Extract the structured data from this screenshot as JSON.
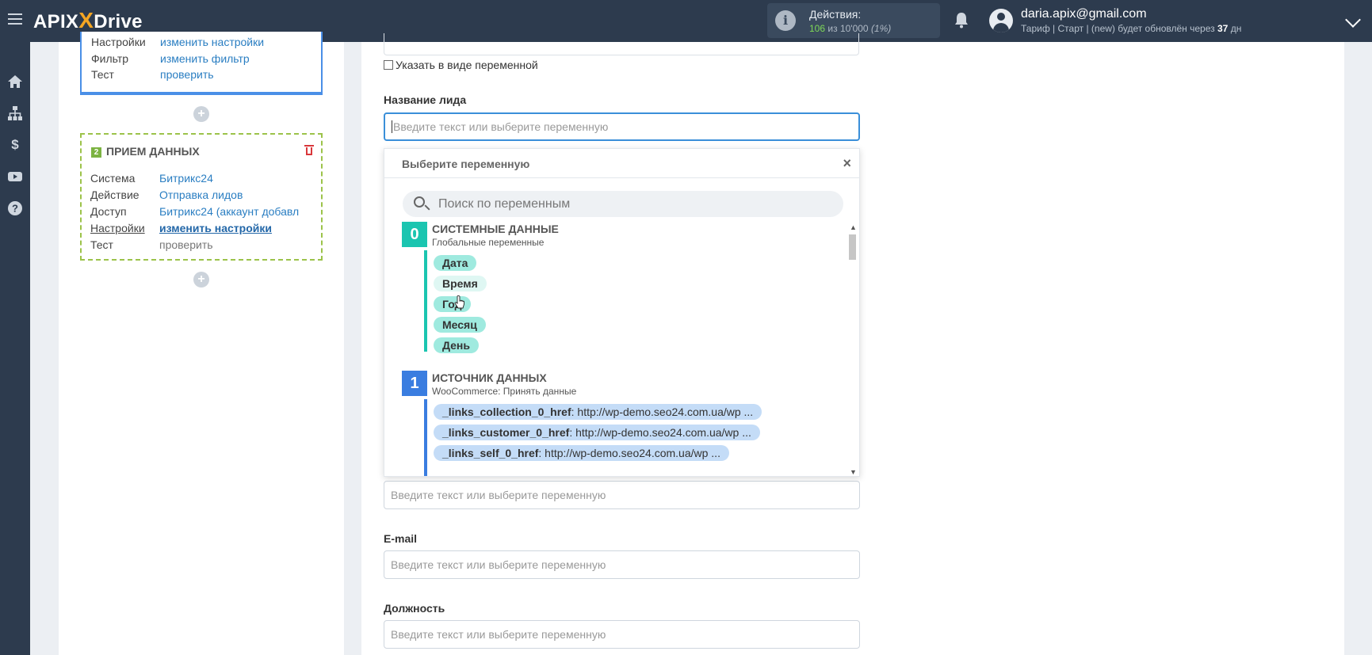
{
  "header": {
    "logo": {
      "left": "APIX",
      "x": "",
      "right": "Drive"
    },
    "actions": {
      "title": "Действия:",
      "used": "106",
      "of_label": "из",
      "total": "10'000",
      "percent": "(1%)"
    },
    "user": {
      "email": "daria.apix@gmail.com",
      "plan_prefix": "Тариф | Старт | (new) будет обновлён через",
      "days": "37",
      "days_unit": "дн"
    }
  },
  "rail": {
    "icons": [
      "home-icon",
      "sitemap-icon",
      "dollar-icon",
      "youtube-icon",
      "help-icon"
    ]
  },
  "step1": {
    "rows": [
      {
        "key": "Настройки",
        "value": "изменить настройки"
      },
      {
        "key": "Фильтр",
        "value": "изменить фильтр"
      },
      {
        "key": "Тест",
        "value": "проверить"
      }
    ]
  },
  "step2": {
    "number": "2",
    "title": "ПРИЕМ ДАННЫХ",
    "rows": [
      {
        "key": "Система",
        "value": "Битрикс24"
      },
      {
        "key": "Действие",
        "value": "Отправка лидов"
      },
      {
        "key": "Доступ",
        "value": "Битрикс24 (аккаунт добавл"
      },
      {
        "key": "Настройки",
        "value": "изменить настройки"
      },
      {
        "key": "Тест",
        "value": "проверить"
      }
    ]
  },
  "form": {
    "checkbox_label": "Указать в виде переменной",
    "lead_name_label": "Название лида",
    "placeholder": "Введите текст или выберите переменную",
    "email_label": "E-mail",
    "position_label": "Должность"
  },
  "dropdown": {
    "title": "Выберите переменную",
    "close": "×",
    "search_placeholder": "Поиск по переменным",
    "sections": [
      {
        "number": "0",
        "title": "СИСТЕМНЫЕ ДАННЫЕ",
        "subtitle": "Глобальные переменные",
        "chips": [
          "Дата",
          "Время",
          "Год",
          "Месяц",
          "День"
        ]
      },
      {
        "number": "1",
        "title": "ИСТОЧНИК ДАННЫХ",
        "subtitle": "WooCommerce: Принять данные",
        "chips": [
          {
            "name": "_links_collection_0_href",
            "value": ": http://wp-demo.seo24.com.ua/wp ..."
          },
          {
            "name": "_links_customer_0_href",
            "value": ": http://wp-demo.seo24.com.ua/wp ..."
          },
          {
            "name": "_links_self_0_href",
            "value": ": http://wp-demo.seo24.com.ua/wp ..."
          }
        ]
      }
    ]
  },
  "colors": {
    "topbar": "#2d3b4e",
    "accent_blue": "#3a8fd9",
    "teal": "#1bc5b0",
    "teal_chip": "#9feadf",
    "blue_section": "#3a7de0",
    "blue_chip": "#c4dcf7",
    "green_step": "#7cb342",
    "link": "#2a7ec2",
    "danger": "#d9373b"
  }
}
